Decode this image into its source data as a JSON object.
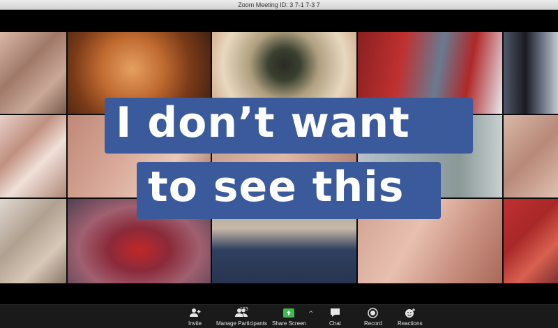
{
  "window": {
    "title": "Zoom Meeting ID: 3  7-1  7-3  7"
  },
  "overlay": {
    "line1": "I don’t want",
    "line2": "to see this",
    "color": "#3a5a9c"
  },
  "toolbar": {
    "invite_label": "Invite",
    "participants_label": "Manage Participants",
    "participants_count": "183",
    "share_label": "Share Screen",
    "share_caret": "^",
    "chat_label": "Chat",
    "record_label": "Record",
    "reactions_label": "Reactions",
    "share_color": "#3fb950"
  },
  "icons": [
    "add-user-icon",
    "participants-icon",
    "share-screen-icon",
    "chat-icon",
    "record-icon",
    "reactions-icon"
  ]
}
